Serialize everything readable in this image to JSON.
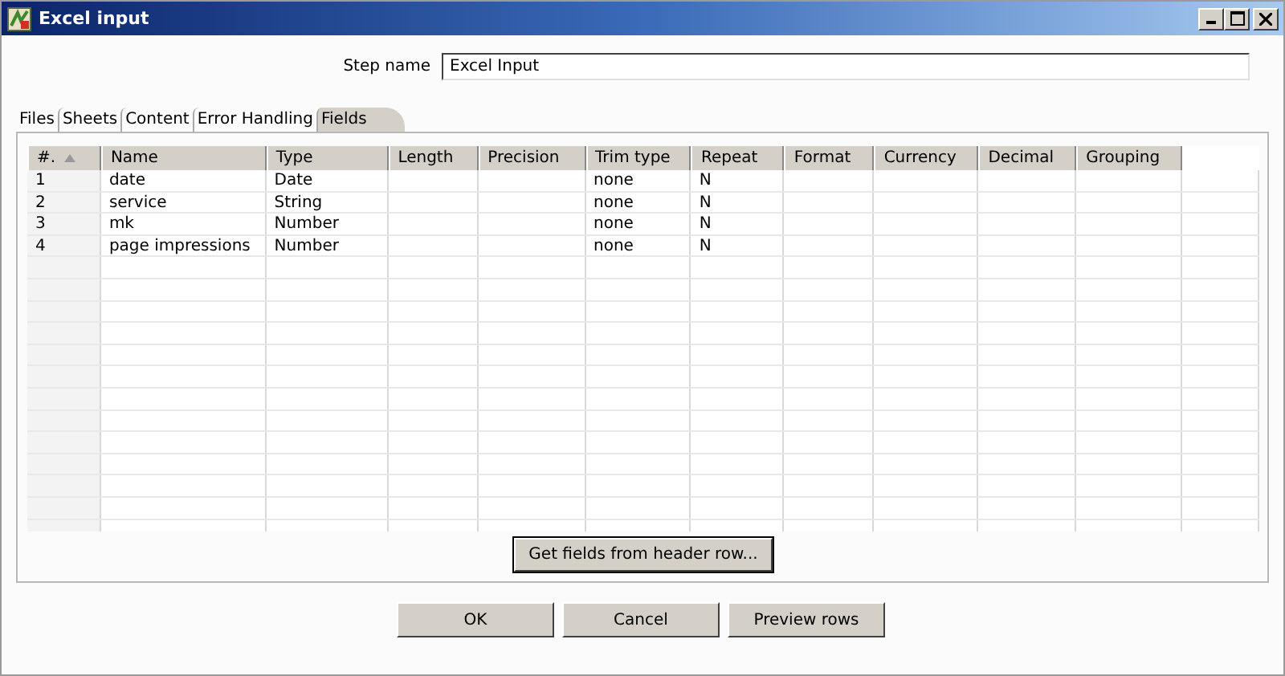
{
  "window": {
    "title": "Excel input"
  },
  "step_name": {
    "label": "Step name",
    "value": "Excel Input"
  },
  "tabs": [
    {
      "label": "Files",
      "selected": false
    },
    {
      "label": "Sheets",
      "selected": false
    },
    {
      "label": "Content",
      "selected": false
    },
    {
      "label": "Error Handling",
      "selected": false
    },
    {
      "label": "Fields",
      "selected": true
    }
  ],
  "table": {
    "columns": [
      "#.",
      "Name",
      "Type",
      "Length",
      "Precision",
      "Trim type",
      "Repeat",
      "Format",
      "Currency",
      "Decimal",
      "Grouping"
    ],
    "rows": [
      [
        "1",
        "date",
        "Date",
        "",
        "",
        "none",
        "N",
        "",
        "",
        "",
        ""
      ],
      [
        "2",
        "service",
        "String",
        "",
        "",
        "none",
        "N",
        "",
        "",
        "",
        ""
      ],
      [
        "3",
        "mk",
        "Number",
        "",
        "",
        "none",
        "N",
        "",
        "",
        "",
        ""
      ],
      [
        "4",
        "page impressions",
        "Number",
        "",
        "",
        "none",
        "N",
        "",
        "",
        "",
        ""
      ]
    ]
  },
  "get_fields_button": "Get fields from header row...",
  "buttons": [
    "OK",
    "Cancel",
    "Preview rows"
  ]
}
